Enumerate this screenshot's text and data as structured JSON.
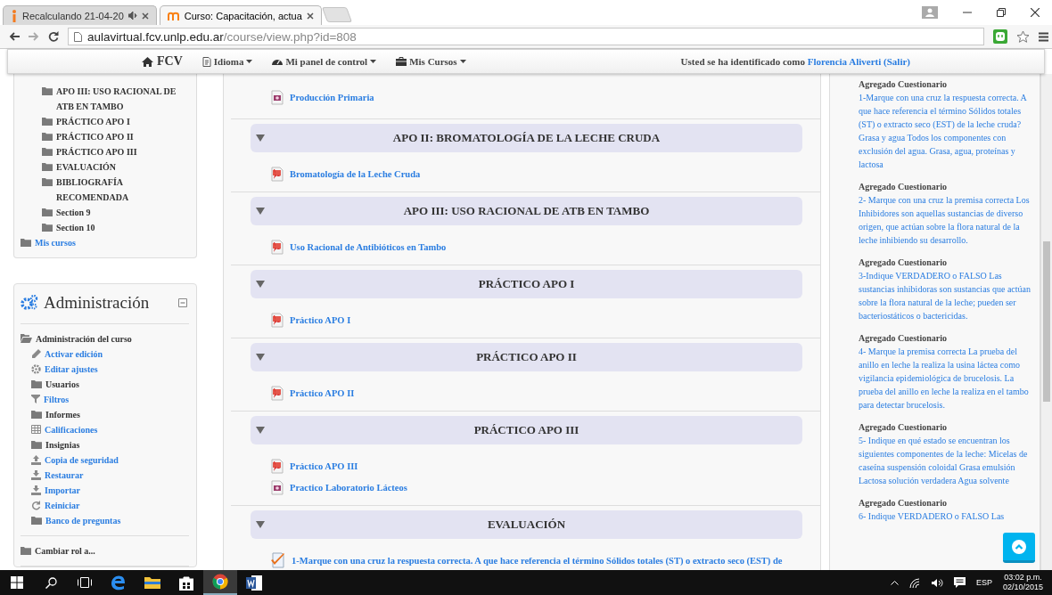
{
  "browser": {
    "tabs": [
      {
        "title": "Recalculando 21-04-20",
        "selected": false,
        "audio": true
      },
      {
        "title": "Curso: Capacitación, actua",
        "selected": true,
        "audio": false
      }
    ],
    "address": {
      "host": "aulavirtual.fcv.unlp.edu.ar",
      "path": "/course/view.php?id=808"
    }
  },
  "navbar": {
    "brand": "FCV",
    "menus": [
      {
        "label": "Idioma",
        "kind": "language"
      },
      {
        "label": "Mi panel de control",
        "kind": "dashboard"
      },
      {
        "label": "Mis Cursos",
        "kind": "briefcase"
      }
    ],
    "login": {
      "prefix": "Usted se ha identificado como",
      "user": "Florencia Aliverti",
      "open": "(",
      "logout": "Salir",
      "close": ")"
    }
  },
  "navigation": {
    "sections": [
      {
        "label": "APO III: USO RACIONAL DE ATB EN TAMBO"
      },
      {
        "label": "PRÁCTICO APO I"
      },
      {
        "label": "PRÁCTICO APO II"
      },
      {
        "label": "PRÁCTICO APO III"
      },
      {
        "label": "EVALUACIÓN"
      },
      {
        "label": "BIBLIOGRAFÍA RECOMENDADA"
      },
      {
        "label": "Section 9"
      },
      {
        "label": "Section 10"
      }
    ],
    "my_courses": {
      "label": "Mis cursos",
      "link": true
    }
  },
  "administration": {
    "title": "Administración",
    "items": [
      {
        "label": "Administración del curso",
        "kind": "folder",
        "link": false,
        "expanded": true,
        "children": [
          {
            "label": "Activar edición",
            "kind": "pencil",
            "link": true
          },
          {
            "label": "Editar ajustes",
            "kind": "gear",
            "link": true
          },
          {
            "label": "Usuarios",
            "kind": "folder",
            "link": false
          },
          {
            "label": "Filtros",
            "kind": "filter",
            "link": true
          },
          {
            "label": "Informes",
            "kind": "folder",
            "link": false
          },
          {
            "label": "Calificaciones",
            "kind": "table",
            "link": true
          },
          {
            "label": "Insignias",
            "kind": "folder",
            "link": false
          },
          {
            "label": "Copia de seguridad",
            "kind": "upload",
            "link": true
          },
          {
            "label": "Restaurar",
            "kind": "download",
            "link": true
          },
          {
            "label": "Importar",
            "kind": "download",
            "link": true
          },
          {
            "label": "Reiniciar",
            "kind": "refresh",
            "link": true
          },
          {
            "label": "Banco de preguntas",
            "kind": "folder",
            "link": true
          }
        ]
      },
      {
        "label": "Cambiar rol a...",
        "kind": "folder",
        "link": false
      }
    ]
  },
  "course": {
    "leading_activities": [
      {
        "kind": "image",
        "label": "Producción Primaria"
      }
    ],
    "sections": [
      {
        "title": "APO II: BROMATOLOGÍA DE LA LECHE CRUDA",
        "expanded": true,
        "activities": [
          {
            "kind": "pdf",
            "label": "Bromatología de la Leche Cruda"
          }
        ]
      },
      {
        "title": "APO III: USO RACIONAL DE ATB EN TAMBO",
        "expanded": true,
        "activities": [
          {
            "kind": "pdf",
            "label": "Uso Racional de Antibióticos en Tambo"
          }
        ]
      },
      {
        "title": "PRÁCTICO APO I",
        "expanded": true,
        "activities": [
          {
            "kind": "pdf",
            "label": "Práctico APO I"
          }
        ]
      },
      {
        "title": "PRÁCTICO APO II",
        "expanded": true,
        "activities": [
          {
            "kind": "pdf",
            "label": "Práctico APO II"
          }
        ]
      },
      {
        "title": "PRÁCTICO APO III",
        "expanded": true,
        "activities": [
          {
            "kind": "pdf",
            "label": "Práctico APO III"
          },
          {
            "kind": "image",
            "label": "Practico Laboratorio Lácteos"
          }
        ]
      },
      {
        "title": "EVALUACIÓN",
        "expanded": true,
        "activities": [
          {
            "kind": "quiz",
            "label": "1-Marque con una cruz la respuesta correcta. A que hace referencia el término Sólidos totales (ST) o extracto seco (EST) de"
          }
        ]
      }
    ]
  },
  "recent_activity": [
    {
      "heading": "Agregado Cuestionario",
      "text": "1-Marque con una cruz la respuesta correcta. A que hace referencia el término Sólidos totales (ST) o extracto seco (EST) de la leche cruda? Grasa y agua Todos los componentes con exclusión del agua. Grasa, agua, proteínas y lactosa"
    },
    {
      "heading": "Agregado Cuestionario",
      "text": "2- Marque con una cruz la premisa correcta Los Inhibidores son aquellas sustancias de diverso origen, que actúan sobre la flora natural de la leche inhibiendo su desarrollo."
    },
    {
      "heading": "Agregado Cuestionario",
      "text": "3-Indique VERDADERO o FALSO Las sustancias inhibidoras son sustancias que actúan sobre la flora natural de la leche; pueden ser bacteriostáticos o bactericidas."
    },
    {
      "heading": "Agregado Cuestionario",
      "text": "4- Marque la premisa correcta La prueba del anillo en leche la realiza la usina láctea como vigilancia epidemiológica de brucelosis. La prueba del anillo en leche la realiza en el tambo para detectar brucelosis."
    },
    {
      "heading": "Agregado Cuestionario",
      "text": "5- Indique en qué estado se encuentran los siguientes componentes de la leche: Micelas de caseína suspensión coloidal Grasa emulsión Lactosa solución verdadera Agua solvente"
    },
    {
      "heading": "Agregado Cuestionario",
      "text": "6- Indique VERDADERO o FALSO Las"
    }
  ],
  "taskbar": {
    "apps": [
      {
        "kind": "edge",
        "selected": false
      },
      {
        "kind": "explorer",
        "selected": false
      },
      {
        "kind": "store",
        "selected": false
      },
      {
        "kind": "chrome",
        "selected": true
      },
      {
        "kind": "word",
        "selected": false
      }
    ],
    "language": "ESP",
    "time": "03:02 p.m.",
    "date": "02/10/2015"
  }
}
